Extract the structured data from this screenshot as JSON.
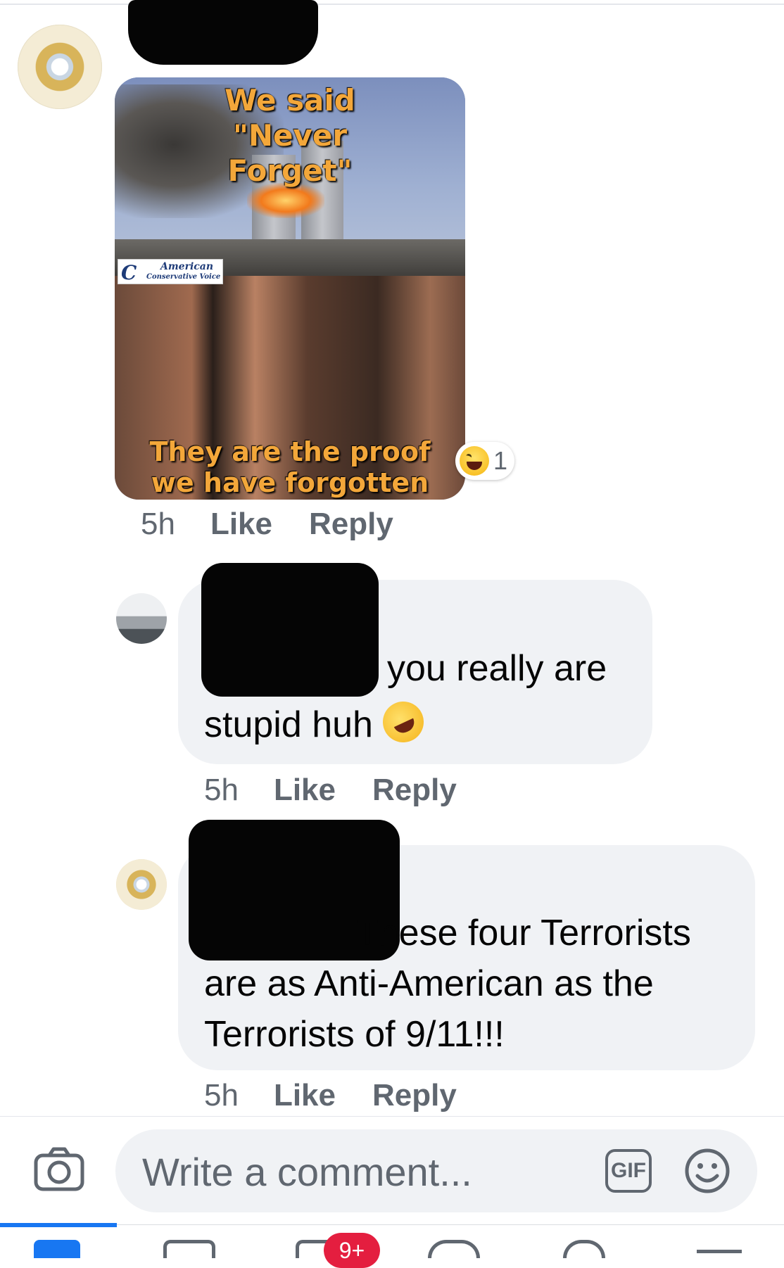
{
  "comments": [
    {
      "author": "[redacted]",
      "image": {
        "caption_top": "We said \"Never Forget\"",
        "caption_bottom": "They are the proof we have forgotten",
        "watermark_line1": "American",
        "watermark_line2": "Conservative Voice"
      },
      "reaction": {
        "type": "haha",
        "count": "1"
      },
      "time": "5h",
      "like_label": "Like",
      "reply_label": "Reply"
    },
    {
      "author": "[redacted]",
      "text_line1": "you really are",
      "text_line2": "stupid huh",
      "emoji": "rolling-on-the-floor-laughing",
      "time": "5h",
      "like_label": "Like",
      "reply_label": "Reply"
    },
    {
      "author": "[redacted]",
      "text_line1": "These four Terrorists",
      "text_line2": "are as Anti-American as the",
      "text_line3": "Terrorists of 9/11!!!",
      "time": "5h",
      "like_label": "Like",
      "reply_label": "Reply"
    }
  ],
  "composer": {
    "placeholder": "Write a comment...",
    "gif_label": "GIF"
  },
  "tabbar": {
    "notifications_badge": "9+",
    "active_color": "#1877f2"
  }
}
